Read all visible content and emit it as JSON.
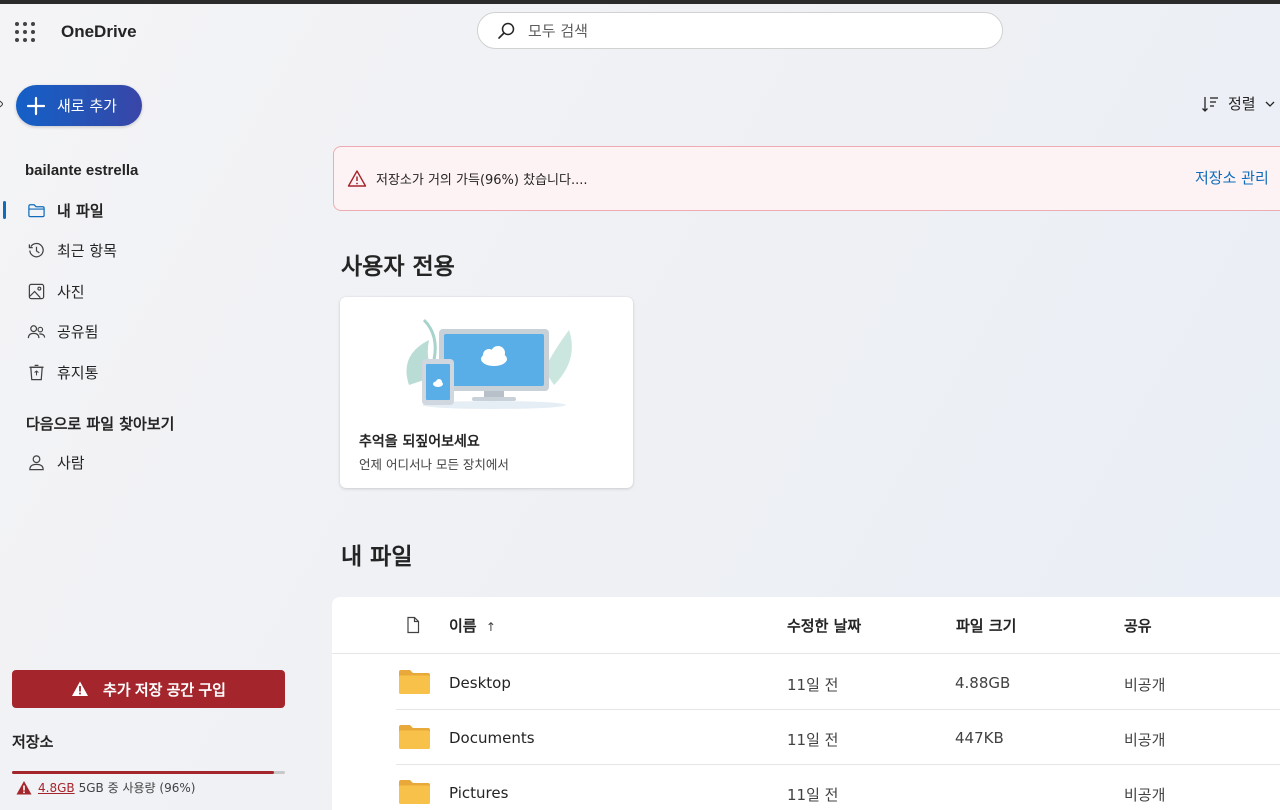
{
  "app": {
    "brand": "OneDrive"
  },
  "search": {
    "placeholder": "모두 검색"
  },
  "sidebar": {
    "new_button": "새로 추가",
    "user_name": "bailante estrella",
    "items": [
      {
        "label": "내 파일",
        "icon": "folder-icon",
        "active": true
      },
      {
        "label": "최근 항목",
        "icon": "history-icon"
      },
      {
        "label": "사진",
        "icon": "image-icon"
      },
      {
        "label": "공유됨",
        "icon": "people-icon"
      },
      {
        "label": "휴지통",
        "icon": "recycle-bin-icon"
      }
    ],
    "browse_title": "다음으로 파일 찾아보기",
    "browse_items": [
      {
        "label": "사람",
        "icon": "person-icon"
      }
    ],
    "buy_button": "추가 저장 공간 구입",
    "storage": {
      "title": "저장소",
      "used": "4.8GB",
      "rest": "5GB 중 사용량 (96%)",
      "percent": 96
    }
  },
  "toolbar": {
    "sort_label": "정렬"
  },
  "alert": {
    "message": "저장소가 거의 가득(96%) 찼습니다....",
    "link": "저장소 관리"
  },
  "for_you": {
    "title": "사용자 전용",
    "card": {
      "title": "추억을 되짚어보세요",
      "subtitle": "언제 어디서나 모든 장치에서"
    }
  },
  "my_files": {
    "title": "내 파일",
    "columns": {
      "name": "이름",
      "modified": "수정한 날짜",
      "size": "파일 크기",
      "sharing": "공유"
    },
    "sort_indicator": "↑",
    "rows": [
      {
        "name": "Desktop",
        "modified": "11일 전",
        "size": "4.88GB",
        "sharing": "비공개"
      },
      {
        "name": "Documents",
        "modified": "11일 전",
        "size": "447KB",
        "sharing": "비공개"
      },
      {
        "name": "Pictures",
        "modified": "11일 전",
        "size": "",
        "sharing": "비공개"
      }
    ]
  },
  "colors": {
    "accent": "#0f6cbd",
    "danger": "#a4262c",
    "folder": "#f8c24a"
  }
}
